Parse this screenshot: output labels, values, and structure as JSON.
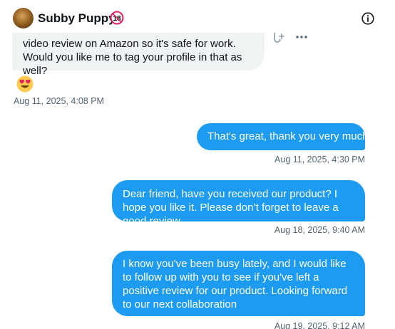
{
  "header": {
    "contact_name": "Subby Puppy",
    "age_badge": "18",
    "avatar_icon": "avatar",
    "info_icon": "info-icon"
  },
  "messages": [
    {
      "direction": "received",
      "text": "video review on Amazon so it's safe for work. Would you like me to tag your profile in that as well?",
      "reaction": "heart-eyes-emoji",
      "timestamp": "Aug 11, 2025, 4:08 PM"
    },
    {
      "direction": "sent",
      "text": "That's great, thank you very much",
      "timestamp": "Aug 11, 2025, 4:30 PM"
    },
    {
      "direction": "sent",
      "text": "Dear friend, have you received our product? I hope you like it. Please don’t forget to leave a good review.",
      "timestamp": "Aug 18, 2025, 9:40 AM"
    },
    {
      "direction": "sent",
      "text": "I know you've been busy lately, and I would like to follow up with you to see if you've left a positive review for our product. Looking forward to our next collaboration",
      "timestamp": "Aug 19, 2025, 9:12 AM"
    }
  ],
  "colors": {
    "sent_bubble": "#1d9bf0",
    "received_bubble": "#eff3f4",
    "timestamp": "#536471",
    "age_badge": "#e0245e"
  }
}
